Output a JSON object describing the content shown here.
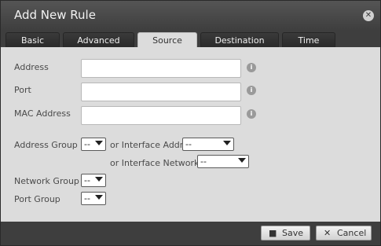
{
  "dialog": {
    "title": "Add New Rule"
  },
  "tabs": [
    {
      "label": "Basic"
    },
    {
      "label": "Advanced"
    },
    {
      "label": "Source"
    },
    {
      "label": "Destination"
    },
    {
      "label": "Time"
    }
  ],
  "active_tab": "Source",
  "form": {
    "address_label": "Address",
    "address_value": "",
    "port_label": "Port",
    "port_value": "",
    "mac_label": "MAC Address",
    "mac_value": "",
    "address_group_label": "Address Group",
    "address_group_value": "--",
    "or_interface_addr_label": "or Interface Addr",
    "interface_addr_value": "--",
    "or_interface_network_label": "or Interface Network",
    "interface_network_value": "--",
    "network_group_label": "Network Group",
    "network_group_value": "--",
    "port_group_label": "Port Group",
    "port_group_value": "--"
  },
  "footer": {
    "save_label": "Save",
    "cancel_label": "Cancel"
  },
  "icons": {
    "close": "close-icon",
    "info": "info-icon",
    "save": "floppy-icon",
    "cancel": "x-icon"
  }
}
